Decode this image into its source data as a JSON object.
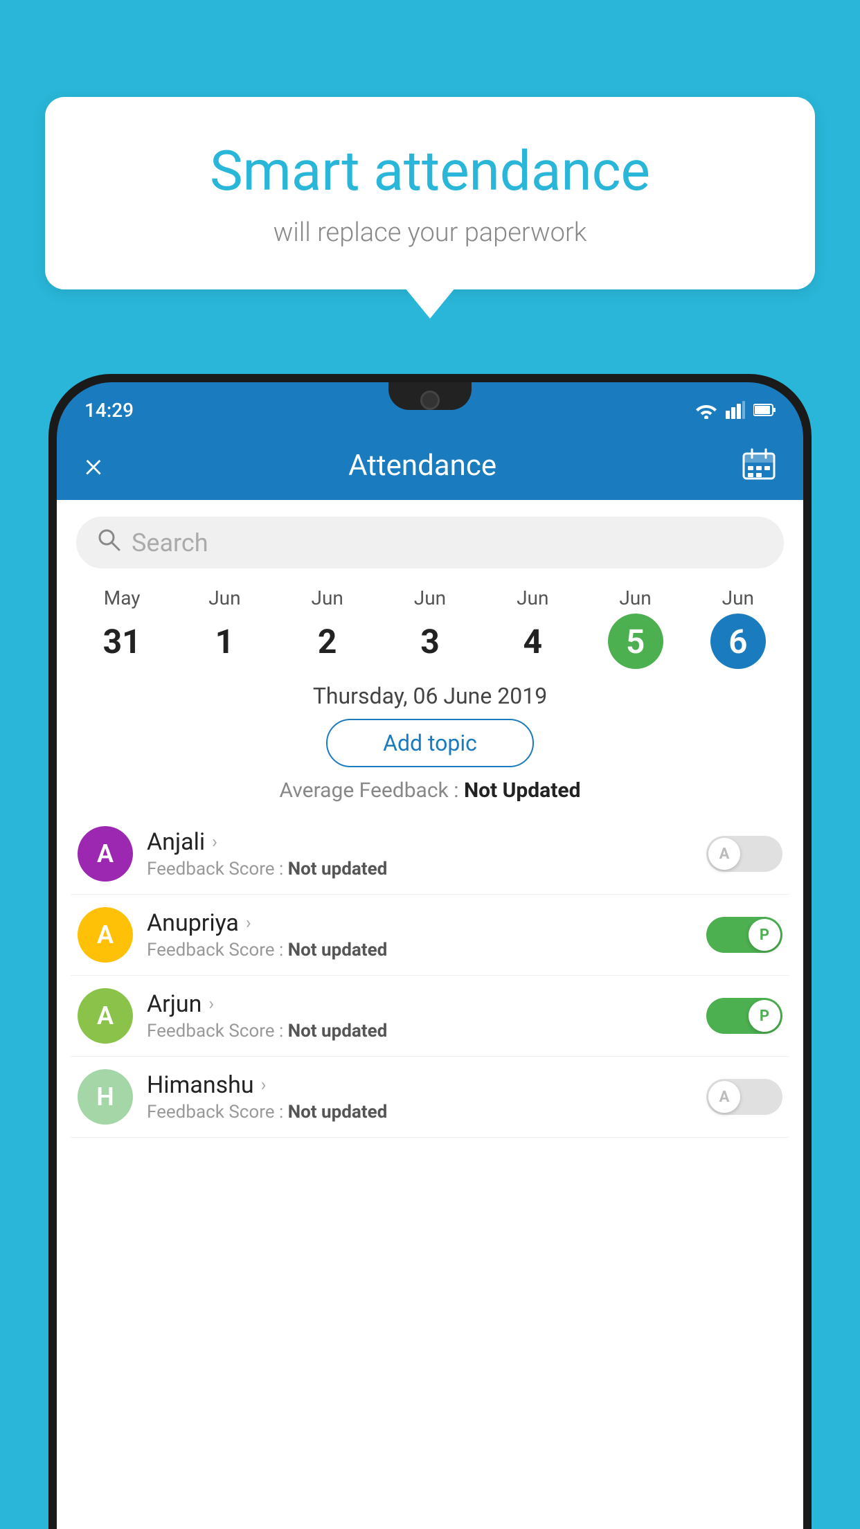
{
  "background_color": "#29b6d8",
  "bubble": {
    "title": "Smart attendance",
    "subtitle": "will replace your paperwork"
  },
  "status_bar": {
    "time": "14:29",
    "wifi_icon": "wifi",
    "signal_icon": "signal",
    "battery_icon": "battery"
  },
  "header": {
    "title": "Attendance",
    "close_label": "×",
    "calendar_icon": "calendar"
  },
  "search": {
    "placeholder": "Search"
  },
  "dates": [
    {
      "month": "May",
      "day": "31",
      "state": "normal"
    },
    {
      "month": "Jun",
      "day": "1",
      "state": "normal"
    },
    {
      "month": "Jun",
      "day": "2",
      "state": "normal"
    },
    {
      "month": "Jun",
      "day": "3",
      "state": "normal"
    },
    {
      "month": "Jun",
      "day": "4",
      "state": "normal"
    },
    {
      "month": "Jun",
      "day": "5",
      "state": "today"
    },
    {
      "month": "Jun",
      "day": "6",
      "state": "selected"
    }
  ],
  "selected_date_label": "Thursday, 06 June 2019",
  "add_topic_label": "Add topic",
  "feedback_label": "Average Feedback :",
  "feedback_value": "Not Updated",
  "students": [
    {
      "name": "Anjali",
      "avatar_letter": "A",
      "avatar_color": "#9c27b0",
      "feedback_label": "Feedback Score :",
      "feedback_value": "Not updated",
      "attendance": "absent",
      "toggle_letter": "A"
    },
    {
      "name": "Anupriya",
      "avatar_letter": "A",
      "avatar_color": "#ffc107",
      "feedback_label": "Feedback Score :",
      "feedback_value": "Not updated",
      "attendance": "present",
      "toggle_letter": "P"
    },
    {
      "name": "Arjun",
      "avatar_letter": "A",
      "avatar_color": "#8bc34a",
      "feedback_label": "Feedback Score :",
      "feedback_value": "Not updated",
      "attendance": "present",
      "toggle_letter": "P"
    },
    {
      "name": "Himanshu",
      "avatar_letter": "H",
      "avatar_color": "#a5d6a7",
      "feedback_label": "Feedback Score :",
      "feedback_value": "Not updated",
      "attendance": "absent",
      "toggle_letter": "A"
    }
  ]
}
